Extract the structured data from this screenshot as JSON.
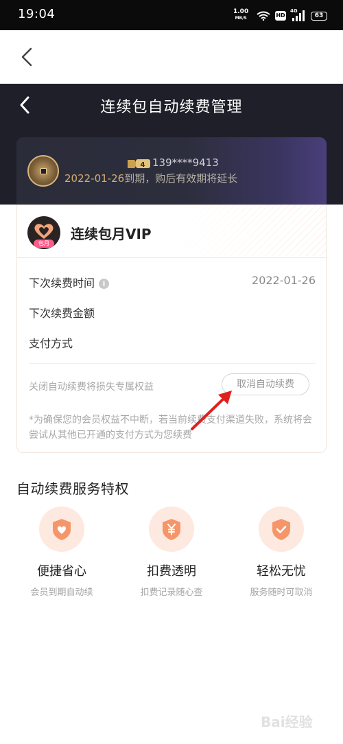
{
  "status_bar": {
    "time": "19:04",
    "net_speed": "1.00",
    "net_unit": "MB/S",
    "hd_label": "HD",
    "signal_label": "4G",
    "battery": "63"
  },
  "header": {
    "title": "连续包自动续费管理"
  },
  "user": {
    "level": "4",
    "phone": "139****9413",
    "expire_date": "2022-01-26",
    "expire_text": "到期，购后有效期将延长"
  },
  "plan": {
    "name": "连续包月VIP",
    "icon_tag": "包月"
  },
  "details": [
    {
      "label": "下次续费时间",
      "value": "2022-01-26"
    },
    {
      "label": "下次续费金额",
      "value": ""
    },
    {
      "label": "支付方式",
      "value": ""
    }
  ],
  "warning": {
    "text": "关闭自动续费将损失专属权益",
    "cancel_label": "取消自动续费"
  },
  "note": "*为确保您的会员权益不中断，若当前续费支付渠道失败，系统将会尝试从其他已开通的支付方式为您续费",
  "privileges": {
    "title": "自动续费服务特权",
    "items": [
      {
        "title": "便捷省心",
        "subtitle": "会员到期自动续",
        "icon": "heart-shield-icon"
      },
      {
        "title": "扣费透明",
        "subtitle": "扣费记录随心查",
        "icon": "yuan-shield-icon"
      },
      {
        "title": "轻松无忧",
        "subtitle": "服务随时可取消",
        "icon": "check-shield-icon"
      }
    ]
  },
  "watermark": "Bai经验",
  "colors": {
    "accent_orange": "#f27a4a",
    "gold": "#d4ad6b",
    "dark_header": "#1f1f29"
  }
}
